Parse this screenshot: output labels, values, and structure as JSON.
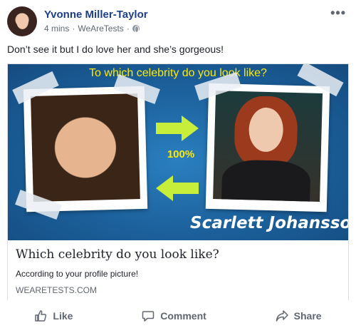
{
  "post": {
    "author": "Yvonne Miller-Taylor",
    "time": "4 mins",
    "app": "WeAreTests",
    "separator": "·",
    "text": "Don’t see it but I do love her and she’s gorgeous!",
    "privacy_icon": "globe-icon",
    "more_icon": "more-options-icon"
  },
  "preview": {
    "title": "To which celebrity do you look like?",
    "percent": "100%",
    "celebrity_name": "Scarlett Johansson",
    "colors": {
      "background": "#1b5f9a",
      "title": "#ffe900",
      "arrow": "#c6ee3a"
    }
  },
  "link": {
    "title": "Which celebrity do you look like?",
    "description": "According to your profile picture!",
    "domain": "WEARETESTS.COM"
  },
  "actions": [
    {
      "label": "Like",
      "icon": "thumbs-up-icon"
    },
    {
      "label": "Comment",
      "icon": "comment-icon"
    },
    {
      "label": "Share",
      "icon": "share-icon"
    }
  ]
}
